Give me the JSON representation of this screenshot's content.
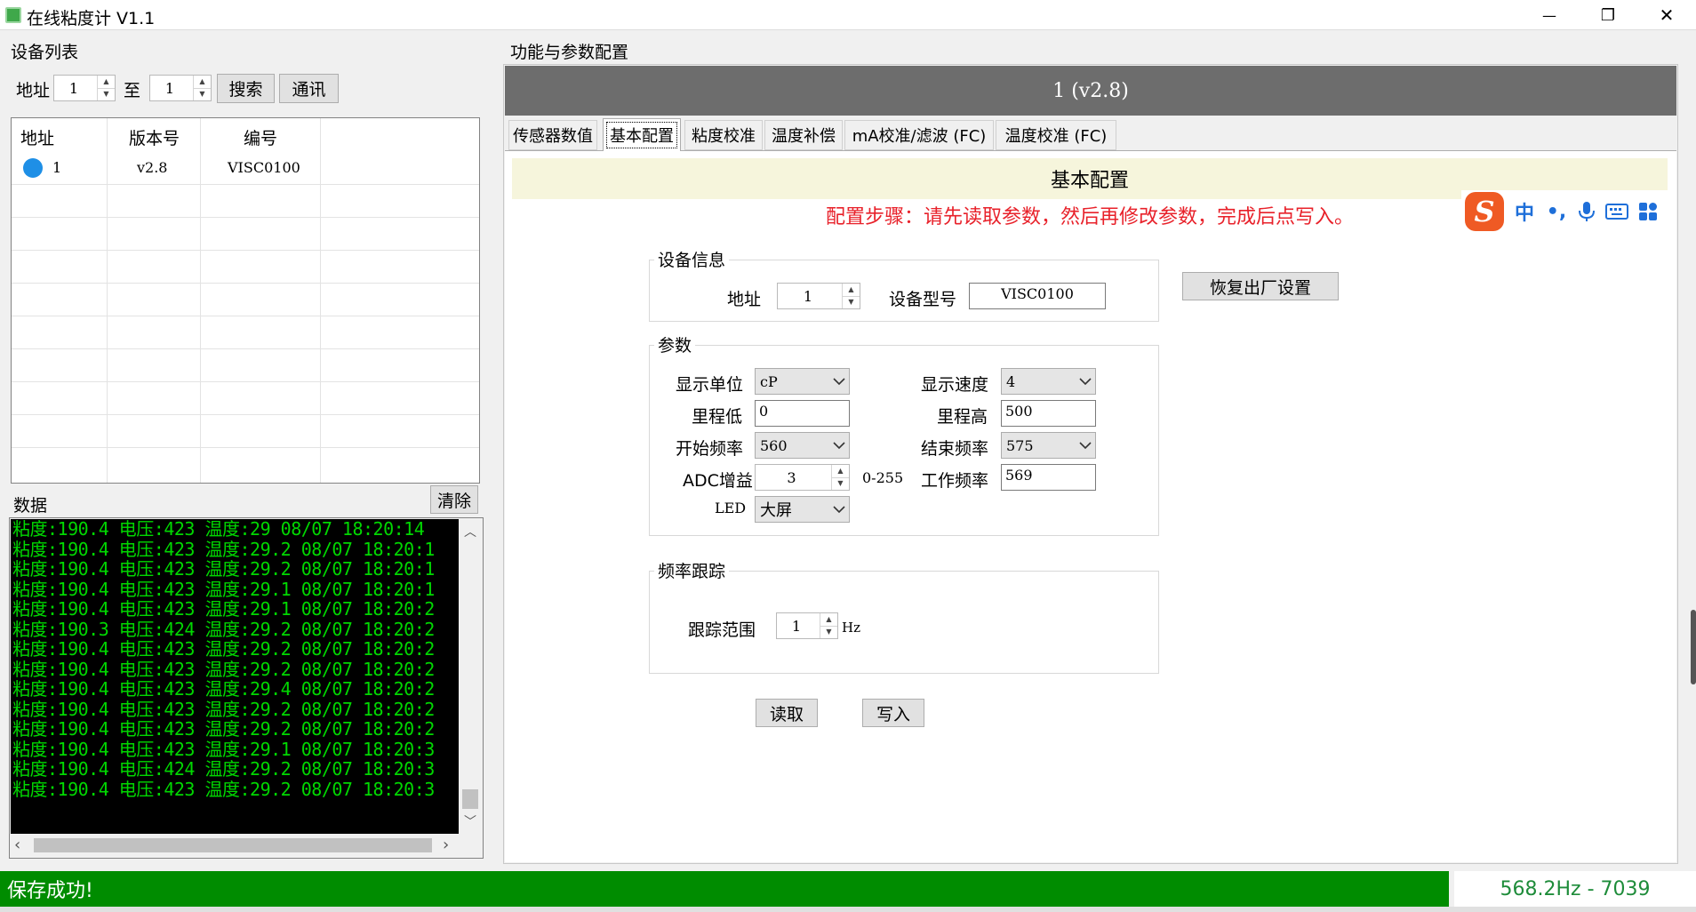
{
  "window": {
    "title": "在线粘度计 V1.1",
    "minimize_glyph": "—",
    "restore_glyph": "❐",
    "close_glyph": "✕"
  },
  "device_list": {
    "title": "设备列表",
    "address_label": "地址",
    "from_value": "1",
    "to_label": "至",
    "to_value": "1",
    "search_label": "搜索",
    "comm_label": "通讯",
    "columns": [
      "地址",
      "版本号",
      "编号"
    ],
    "rows": [
      {
        "address": "1",
        "version": "v2.8",
        "serial": "VISC0100",
        "status_color": "#1e8fe6"
      }
    ]
  },
  "data_panel": {
    "title": "数据",
    "clear_label": "清除",
    "log_lines": [
      "粘度:190.4 电压:423 温度:29 08/07 18:20:14",
      "粘度:190.4 电压:423 温度:29.2 08/07 18:20:1",
      "粘度:190.4 电压:423 温度:29.2 08/07 18:20:1",
      "粘度:190.4 电压:423 温度:29.1 08/07 18:20:1",
      "粘度:190.4 电压:423 温度:29.1 08/07 18:20:2",
      "粘度:190.3 电压:424 温度:29.2 08/07 18:20:2",
      "粘度:190.4 电压:423 温度:29.2 08/07 18:20:2",
      "粘度:190.4 电压:423 温度:29.2 08/07 18:20:2",
      "粘度:190.4 电压:423 温度:29.4 08/07 18:20:2",
      "粘度:190.4 电压:423 温度:29.2 08/07 18:20:2",
      "粘度:190.4 电压:423 温度:29.2 08/07 18:20:2",
      "粘度:190.4 电压:423 温度:29.1 08/07 18:20:3",
      "粘度:190.4 电压:424 温度:29.2 08/07 18:20:3",
      "粘度:190.4 电压:423 温度:29.2 08/07 18:20:3"
    ],
    "log_color": "#00d800"
  },
  "config": {
    "section_title": "功能与参数配置",
    "device_header": "1 (v2.8)",
    "tabs": [
      "传感器数值",
      "基本配置",
      "粘度校准",
      "温度补偿",
      "mA校准/滤波 (FC)",
      "温度校准 (FC)"
    ],
    "active_tab": "基本配置",
    "panel_title": "基本配置",
    "hint": "配置步骤：请先读取参数，然后再修改参数，完成后点写入。",
    "device_info": {
      "legend": "设备信息",
      "address_label": "地址",
      "address_value": "1",
      "model_label": "设备型号",
      "model_value": "VISC0100"
    },
    "factory_reset_label": "恢复出厂设置",
    "params": {
      "legend": "参数",
      "unit_label": "显示单位",
      "unit_value": "cP",
      "speed_label": "显示速度",
      "speed_value": "4",
      "range_low_label": "里程低",
      "range_low_value": "0",
      "range_high_label": "里程高",
      "range_high_value": "500",
      "start_freq_label": "开始频率",
      "start_freq_value": "560",
      "end_freq_label": "结束频率",
      "end_freq_value": "575",
      "adc_label": "ADC增益",
      "adc_value": "3",
      "adc_range": "0-255",
      "work_freq_label": "工作频率",
      "work_freq_value": "569",
      "led_label": "LED",
      "led_value": "大屏"
    },
    "tracking": {
      "legend": "频率跟踪",
      "range_label": "跟踪范围",
      "range_value": "1",
      "unit": "Hz"
    },
    "read_label": "读取",
    "write_label": "写入"
  },
  "status": {
    "message": "保存成功!",
    "readout": "568.2Hz - 7039",
    "bar_color": "#008c00"
  },
  "ime": {
    "logo": "S",
    "mode": "中",
    "punct": "•,",
    "mic_icon": "microphone-icon",
    "keyboard_icon": "keyboard-icon",
    "apps_icon": "apps-grid-icon"
  }
}
